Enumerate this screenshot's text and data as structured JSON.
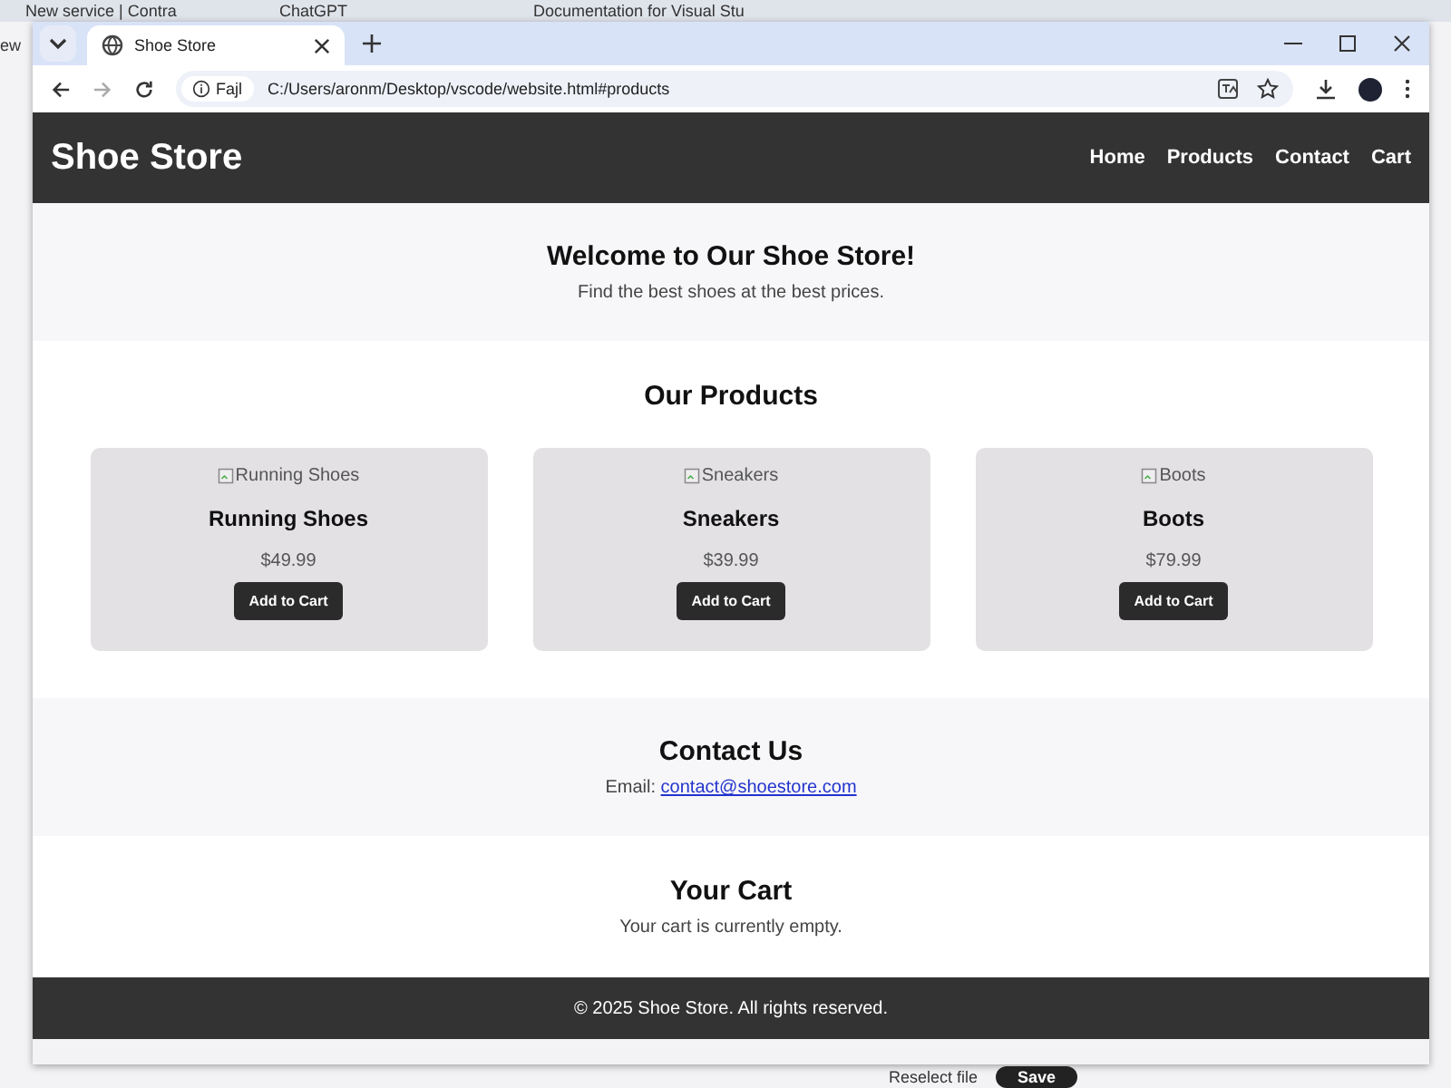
{
  "background_tabs": [
    {
      "title": "New service | Contra"
    },
    {
      "title": "ChatGPT"
    },
    {
      "title": "Documentation for Visual Stu"
    }
  ],
  "background_text": "ew",
  "window": {
    "tab": {
      "title": "Shoe Store"
    },
    "address": {
      "security_label": "Fajl",
      "url": "C:/Users/aronm/Desktop/vscode/website.html#products"
    }
  },
  "page": {
    "header": {
      "logo": "Shoe Store",
      "nav": [
        "Home",
        "Products",
        "Contact",
        "Cart"
      ]
    },
    "hero": {
      "title": "Welcome to Our Shoe Store!",
      "subtitle": "Find the best shoes at the best prices."
    },
    "products": {
      "title": "Our Products",
      "items": [
        {
          "image_alt": "Running Shoes",
          "name": "Running Shoes",
          "price": "$49.99",
          "button": "Add to Cart"
        },
        {
          "image_alt": "Sneakers",
          "name": "Sneakers",
          "price": "$39.99",
          "button": "Add to Cart"
        },
        {
          "image_alt": "Boots",
          "name": "Boots",
          "price": "$79.99",
          "button": "Add to Cart"
        }
      ]
    },
    "contact": {
      "title": "Contact Us",
      "label": "Email:",
      "email": "contact@shoestore.com"
    },
    "cart": {
      "title": "Your Cart",
      "message": "Your cart is currently empty."
    },
    "footer": "© 2025 Shoe Store. All rights reserved."
  },
  "bottom_bar": {
    "reselect": "Reselect file",
    "save": "Save"
  }
}
